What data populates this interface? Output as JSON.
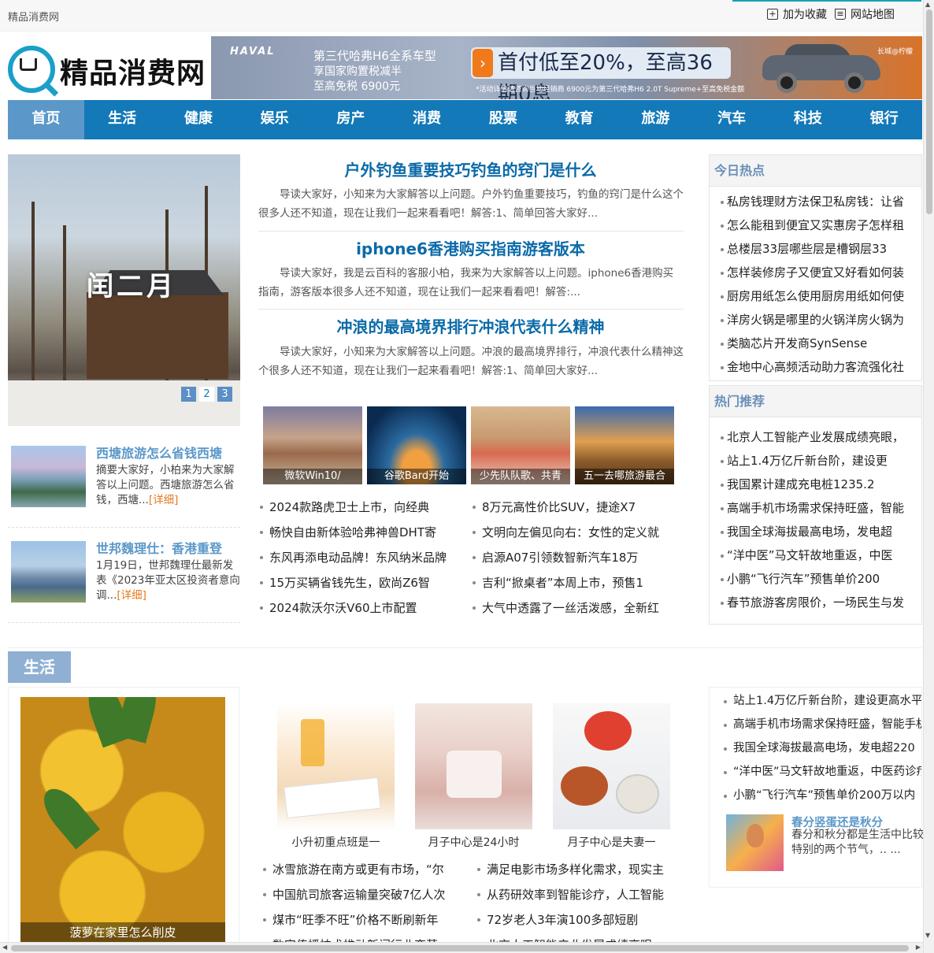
{
  "topbar": {
    "site_name": "精品消费网",
    "favorite": "加为收藏",
    "sitemap": "网站地图"
  },
  "logo": {
    "text": "精品消费网"
  },
  "banner": {
    "brand": "HAVAL",
    "line1": "第三代哈弗H6全系车型",
    "line2": "享国家购置税减半",
    "line3": "至高免税 6900元",
    "offer": "首付低至20%，至高36期0息",
    "fineprint": "*活动详情请咨询当地经销商  6900元为第三代哈弗H6 2.0T Supreme+至高免税金额",
    "brand2": "长城@柠檬"
  },
  "nav": [
    "首页",
    "生活",
    "健康",
    "娱乐",
    "房产",
    "消费",
    "股票",
    "教育",
    "旅游",
    "汽车",
    "科技",
    "银行"
  ],
  "slider": {
    "caption": "闰二月",
    "pages": [
      "1",
      "2",
      "3"
    ]
  },
  "left_news": [
    {
      "title": "西塘旅游怎么省钱西塘",
      "desc": "摘要大家好，小柏来为大家解答以上问题。西塘旅游怎么省钱，西塘...",
      "more": "[详细]"
    },
    {
      "title": "世邦魏理仕：香港重登",
      "desc": "1月19日，世邦魏理仕最新发表《2023年亚太区投资者意向调...",
      "more": "[详细]"
    }
  ],
  "headlines": [
    {
      "title": "户外钓鱼重要技巧钓鱼的窍门是什么",
      "desc": "导读大家好，小知来为大家解答以上问题。户外钓鱼重要技巧，钓鱼的窍门是什么这个很多人还不知道，现在让我们一起来看看吧！解答:1、简单回答大家好..."
    },
    {
      "title": "iphone6香港购买指南游客版本",
      "desc": "导读大家好，我是云百科的客服小柏，我来为大家解答以上问题。iphone6香港购买指南，游客版本很多人还不知道，现在让我们一起来看看吧！解答:..."
    },
    {
      "title": "冲浪的最高境界排行冲浪代表什么精神",
      "desc": "导读大家好，小知来为大家解答以上问题。冲浪的最高境界排行，冲浪代表什么精神这个很多人还不知道，现在让我们一起来看看吧！解答:1、简单回大家好..."
    }
  ],
  "center_pics": [
    "微软Win10/",
    "谷歌Bard开始",
    "少先队队歌、共青",
    "五一去哪旅游最合"
  ],
  "center_list": [
    "2024款路虎卫士上市，向经典",
    "8万元高性价比SUV，捷途X7",
    "畅快自由新体验哈弗神兽DHT寄",
    "文明向左偏见向右：女性的定义就",
    "东风再添电动品牌！东风纳米品牌",
    "启源A07引领数智新汽车18万",
    "15万买辆省钱先生，欧尚Z6智",
    "吉利“掀桌者”本周上市，预售1",
    "2024款沃尔沃V60上市配置",
    "大气中透露了一丝活泼感，全新红"
  ],
  "today_hot": {
    "title": "今日热点",
    "items": [
      "私房钱理财方法保卫私房钱：让省",
      "怎么能租到便宜又实惠房子怎样租",
      "总楼层33层哪些层是槽钢层33",
      "怎样装修房子又便宜又好看如何装",
      "厨房用纸怎么使用厨房用纸如何使",
      "洋房火锅是哪里的火锅洋房火锅为",
      "类脑芯片开发商SynSense",
      "金地中心高频活动助力客流强化社"
    ]
  },
  "hot_rec": {
    "title": "热门推荐",
    "items": [
      "北京人工智能产业发展成绩亮眼，",
      "站上1.4万亿斤新台阶，建设更",
      "我国累计建成充电桩1235.2",
      "高端手机市场需求保持旺盛，智能",
      "我国全球海拔最高电场，发电超",
      "“洋中医”马文轩故地重返，中医",
      "小鹏“飞行汽车”预售单价200",
      "春节旅游客房限价，一场民生与发"
    ]
  },
  "section2": {
    "title": "生活",
    "big_pic_caption": "菠萝在家里怎么削皮",
    "pics": [
      "小升初重点班是一",
      "月子中心是24小时",
      "月子中心是夫妻一"
    ],
    "list": [
      "冰雪旅游在南方或更有市场，“尔",
      "满足电影市场多样化需求，现实主",
      "中国航司旅客运输量突破7亿人次",
      "从药研效率到智能诊疗，人工智能",
      "煤市“旺季不旺”价格不断刷新年",
      "72岁老人3年演100多部短剧",
      "数字传播技术推动新闻行业变革",
      "北京人工智能产业发展成绩亮眼"
    ],
    "side_list": [
      "站上1.4万亿斤新台阶，建设更高水平",
      "高端手机市场需求保持旺盛，智能手机",
      "我国全球海拔最高电场，发电超220",
      "“洋中医”马文轩故地重返，中医药诊疗",
      "小鹏“飞行汽车”预售单价200万以内"
    ],
    "feature": {
      "title": "春分竖蛋还是秋分",
      "desc": "春分和秋分都是生活中比较特别的两个节气，.. ..."
    }
  }
}
